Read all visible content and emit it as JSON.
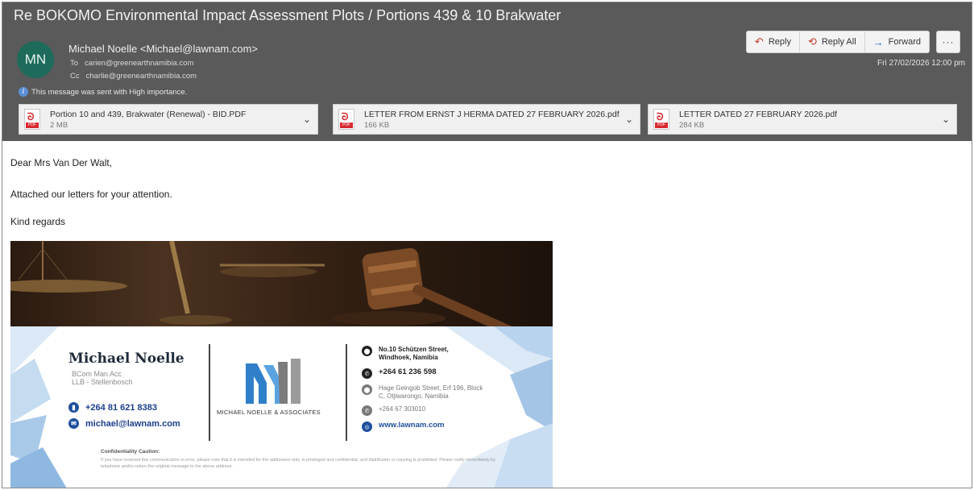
{
  "email": {
    "subject": "Re BOKOMO Environmental Impact Assessment Plots / Portions 439 & 10 Brakwater",
    "avatar_initials": "MN",
    "from": "Michael Noelle <Michael@lawnam.com>",
    "to_label": "To",
    "to": "carien@greenearthnamibia.com",
    "cc_label": "Cc",
    "cc": "charlie@greenearthnamibia.com",
    "importance_note": "This message was sent with High importance.",
    "date": "Fri 27/02/2026 12:00 pm"
  },
  "actions": {
    "reply": "Reply",
    "reply_all": "Reply All",
    "forward": "Forward",
    "more": "···"
  },
  "attachments": [
    {
      "name": "Portion 10 and 439, Brakwater (Renewal) - BID.PDF",
      "size": "2 MB"
    },
    {
      "name": "LETTER FROM ERNST J HERMA DATED 27 FEBRUARY 2026.pdf",
      "size": "166 KB"
    },
    {
      "name": "LETTER DATED 27 FEBRUARY 2026.pdf",
      "size": "284 KB"
    }
  ],
  "body": {
    "greeting": "Dear Mrs Van Der Walt,",
    "line1": "Attached our letters for your attention.",
    "closing": "Kind regards"
  },
  "signature": {
    "name": "Michael Noelle",
    "cred1": "BCom Man Acc",
    "cred2": "LLB - Stellenbosch",
    "phone": "+264 81 621 8383",
    "email": "michael@lawnam.com",
    "firm": "MICHAEL NOELLE & ASSOCIATES",
    "address1_line1": "No.10 Schützen Street,",
    "address1_line2": "Windhoek, Namibia",
    "phone1": "+264 61 236 598",
    "address2_line1": "Hage Geingob Street, Erf 196, Block",
    "address2_line2": "C, Otjiwarongo, Namibia",
    "phone2": "+264 67 303010",
    "website": "www.lawnam.com",
    "caution_title": "Confidentiality Caution:",
    "caution_text": "If you have received this communication in error, please note that it is intended for the addressee only, is privileged and confidential, and distribution or copying is prohibited. Please notify immediately by telephone and/or return the original message to the above address."
  },
  "colors": {
    "header_bg": "#5a5a5a",
    "avatar_bg": "#1e6b5b",
    "link_blue": "#1d4f9c",
    "pdf_red": "#d8282f"
  }
}
